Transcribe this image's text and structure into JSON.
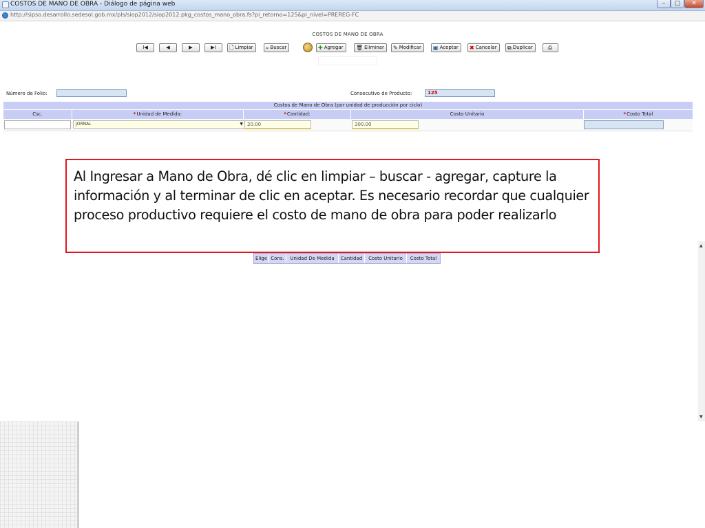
{
  "window": {
    "title": "COSTOS DE MANO DE OBRA - Diálogo de página web",
    "minimize_glyph": "–",
    "maximize_glyph": "□",
    "close_glyph": "✕"
  },
  "address": {
    "url": "http://sipso.desarrollo.sedesol.gob.mx/pls/siop2012/siop2012.pkg_costos_mano_obra.fs?pi_retorno=125&pi_nivel=PREREG-FC"
  },
  "page": {
    "title": "COSTOS DE MANO DE OBRA"
  },
  "toolbar": {
    "first_glyph": "I◀",
    "prev_glyph": "◀",
    "next_glyph": "▶",
    "last_glyph": "▶I",
    "limpiar": "Limpiar",
    "buscar": "Buscar",
    "agregar": "Agregar",
    "eliminar": "Eliminar",
    "modificar": "Modificar",
    "aceptar": "Aceptar",
    "cancelar": "Cancelar",
    "duplicar": "Duplicar",
    "icons": {
      "limpiar": "document-icon",
      "buscar": "magnifier-icon",
      "agregar": "plus-icon",
      "eliminar": "trash-icon",
      "modificar": "edit-icon",
      "aceptar": "save-icon",
      "cancelar": "x-icon",
      "duplicar": "copy-icon",
      "imprimir": "printer-icon"
    }
  },
  "form": {
    "folio_label": "Número de Folio:",
    "folio_value": "",
    "consecutivo_label": "Consecutivo de Producto:",
    "consecutivo_value": "125"
  },
  "grid": {
    "caption": "Costos de Mano de Obra (por unidad de producción por ciclo)",
    "headers": {
      "csc": "Csc.",
      "unidad": "Unidad de Medida:",
      "cantidad": "Cantidad:",
      "costo_unitario": "Costo Unitario",
      "costo_total": "Costo Total"
    },
    "required_mark": "*",
    "row": {
      "csc": "",
      "unidad": "JORNAL",
      "cantidad": "20.00",
      "costo_unitario": "300.00",
      "costo_total": ""
    }
  },
  "callout": {
    "text": "Al Ingresar a Mano de Obra, dé clic en limpiar – buscar - agregar, capture la información y al terminar de clic en aceptar.  Es necesario recordar que cualquier proceso productivo requiere el costo de mano de obra para poder realizarlo"
  },
  "mini_table": {
    "headers": [
      "Elige",
      "Cons.",
      "Unidad De Medida",
      "Cantidad",
      "Costo Unitario",
      "Costo Total"
    ]
  },
  "colors": {
    "grid_header": "#c8cdf5",
    "callout_border": "#e0171f",
    "required": "#d00000"
  }
}
